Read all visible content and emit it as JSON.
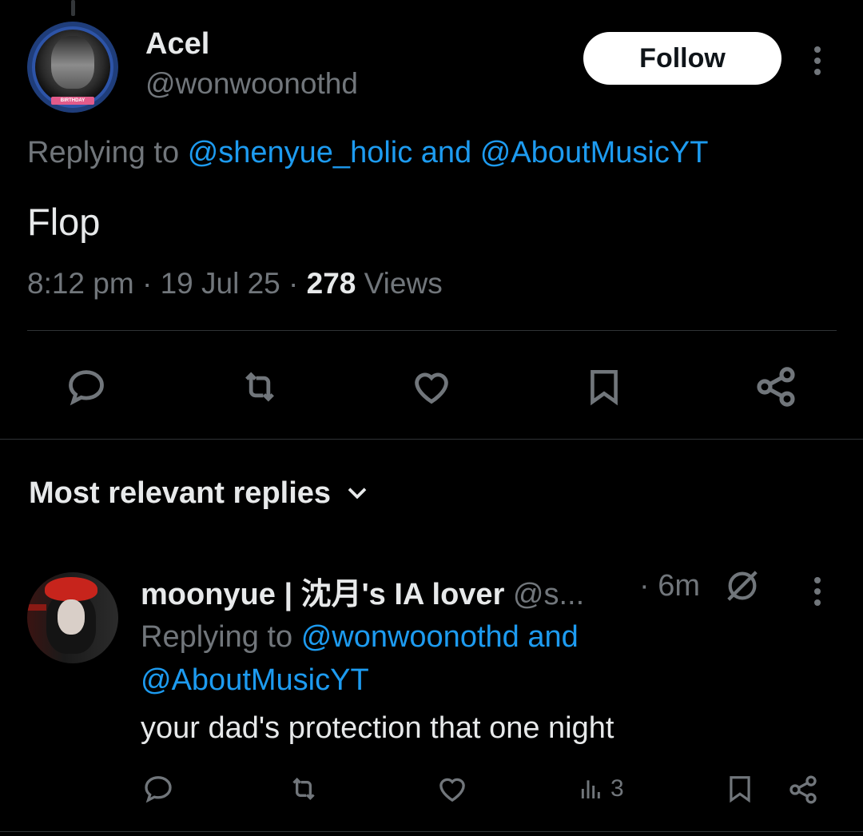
{
  "tweet": {
    "author_name": "Acel",
    "author_handle": "@wonwoonothd",
    "follow_label": "Follow",
    "replying_prefix": "Replying to",
    "replying_mention_1": "@shenyue_holic",
    "replying_and": "and",
    "replying_mention_2": "@AboutMusicYT",
    "text": "Flop",
    "time": "8:12 pm",
    "date": "19 Jul 25",
    "views_count": "278",
    "views_label": "Views",
    "avatar_banner": "BIRTHDAY"
  },
  "replies_sort": {
    "label": "Most relevant replies"
  },
  "reply": {
    "display_name": "moonyue | 沈月's IA lover",
    "handle_truncated": "@s...",
    "time": "6m",
    "replying_prefix": "Replying to",
    "replying_mention_1": "@wonwoonothd",
    "replying_and": "and",
    "replying_mention_2": "@AboutMusicYT",
    "text": "your dad's protection that one night",
    "views_count": "3"
  },
  "icons": {
    "reply": "reply-icon",
    "retweet": "retweet-icon",
    "like": "heart-icon",
    "bookmark": "bookmark-icon",
    "share": "share-icon",
    "views": "views-icon",
    "grok": "grok-icon",
    "more": "more-icon"
  },
  "colors": {
    "background": "#000000",
    "text_primary": "#e7e9ea",
    "text_secondary": "#71767b",
    "link": "#1d9bf0",
    "divider": "#2f3336"
  }
}
